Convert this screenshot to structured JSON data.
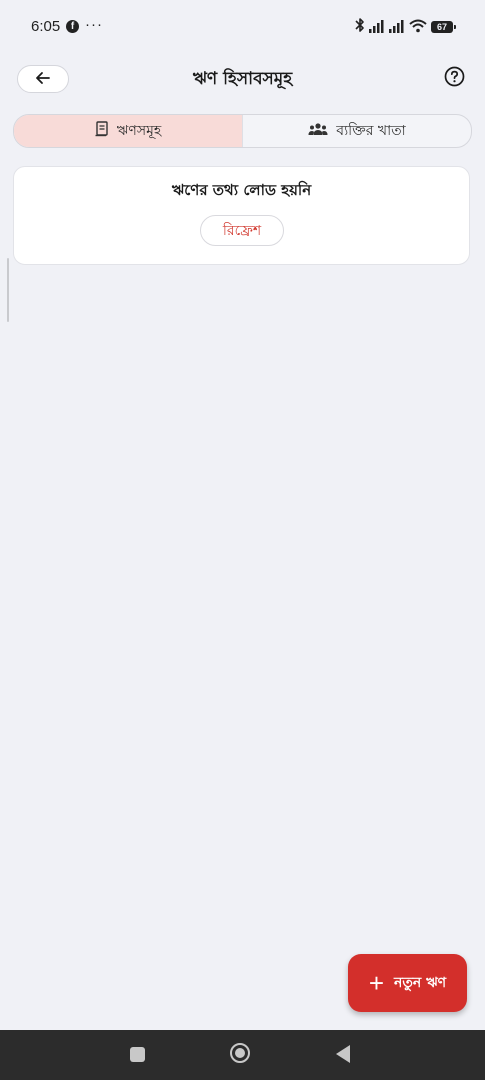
{
  "status_bar": {
    "time": "6:05",
    "notification_icons": [
      "facebook-icon",
      "more-dots-icon"
    ],
    "system_icons": [
      "bluetooth-icon",
      "signal-icon",
      "signal-icon",
      "wifi-icon"
    ],
    "battery_level": "67"
  },
  "header": {
    "title": "ঋণ হিসাবসমূহ",
    "back_icon": "arrow-left-icon",
    "help_icon": "help-circle-icon"
  },
  "tabs": [
    {
      "label": "ঋণসমূহ",
      "icon": "ledger-icon",
      "active": true
    },
    {
      "label": "ব্যক্তির খাতা",
      "icon": "people-group-icon",
      "active": false
    }
  ],
  "card": {
    "message": "ঋণের তথ্য লোড হয়নি",
    "refresh_label": "রিফ্রেশ"
  },
  "fab": {
    "icon": "plus-icon",
    "label": "নতুন ঋণ"
  },
  "colors": {
    "background": "#f0f1f6",
    "accent": "#d32f2b",
    "active_tab": "#f8dbd8",
    "refresh_text": "#d23a30",
    "nav_bar": "#2c2c2c"
  },
  "nav_bar": {
    "icons": [
      "recents-square-icon",
      "home-circle-icon",
      "back-triangle-icon"
    ]
  }
}
